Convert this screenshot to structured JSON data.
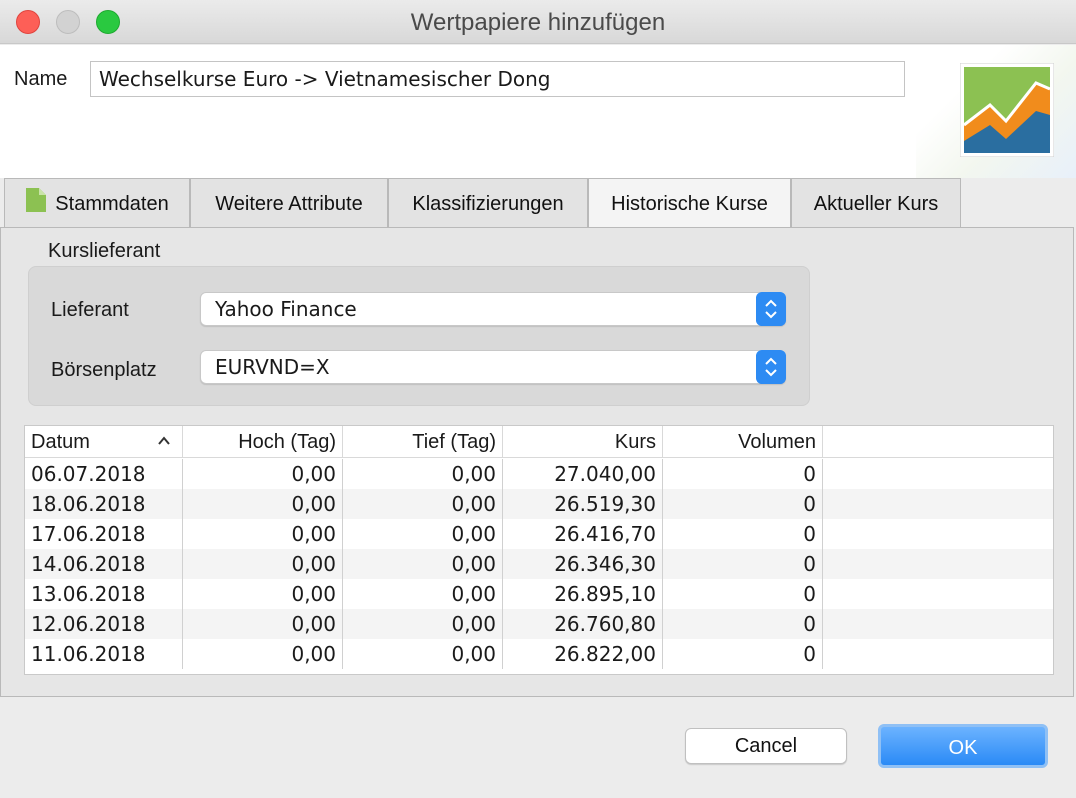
{
  "window": {
    "title": "Wertpapiere hinzufügen"
  },
  "header": {
    "name_label": "Name",
    "name_value": "Wechselkurse Euro -> Vietnamesischer Dong"
  },
  "tabs": [
    {
      "label": "Stammdaten",
      "icon": "document-icon"
    },
    {
      "label": "Weitere Attribute"
    },
    {
      "label": "Klassifizierungen"
    },
    {
      "label": "Historische Kurse",
      "active": true
    },
    {
      "label": "Aktueller Kurs"
    }
  ],
  "provider": {
    "group_title": "Kurslieferant",
    "provider_label": "Lieferant",
    "provider_value": "Yahoo Finance",
    "exchange_label": "Börsenplatz",
    "exchange_value": "EURVND=X"
  },
  "table": {
    "columns": [
      "Datum",
      "Hoch (Tag)",
      "Tief (Tag)",
      "Kurs",
      "Volumen"
    ],
    "sort_column": "Datum",
    "sort_direction": "ascending",
    "rows": [
      [
        "06.07.2018",
        "0,00",
        "0,00",
        "27.040,00",
        "0"
      ],
      [
        "18.06.2018",
        "0,00",
        "0,00",
        "26.519,30",
        "0"
      ],
      [
        "17.06.2018",
        "0,00",
        "0,00",
        "26.416,70",
        "0"
      ],
      [
        "14.06.2018",
        "0,00",
        "0,00",
        "26.346,30",
        "0"
      ],
      [
        "13.06.2018",
        "0,00",
        "0,00",
        "26.895,10",
        "0"
      ],
      [
        "12.06.2018",
        "0,00",
        "0,00",
        "26.760,80",
        "0"
      ],
      [
        "11.06.2018",
        "0,00",
        "0,00",
        "26.822,00",
        "0"
      ]
    ]
  },
  "buttons": {
    "cancel": "Cancel",
    "ok": "OK"
  },
  "colors": {
    "accent": "#2a8af6",
    "close": "#fd5f57",
    "maximize": "#2ac940"
  }
}
